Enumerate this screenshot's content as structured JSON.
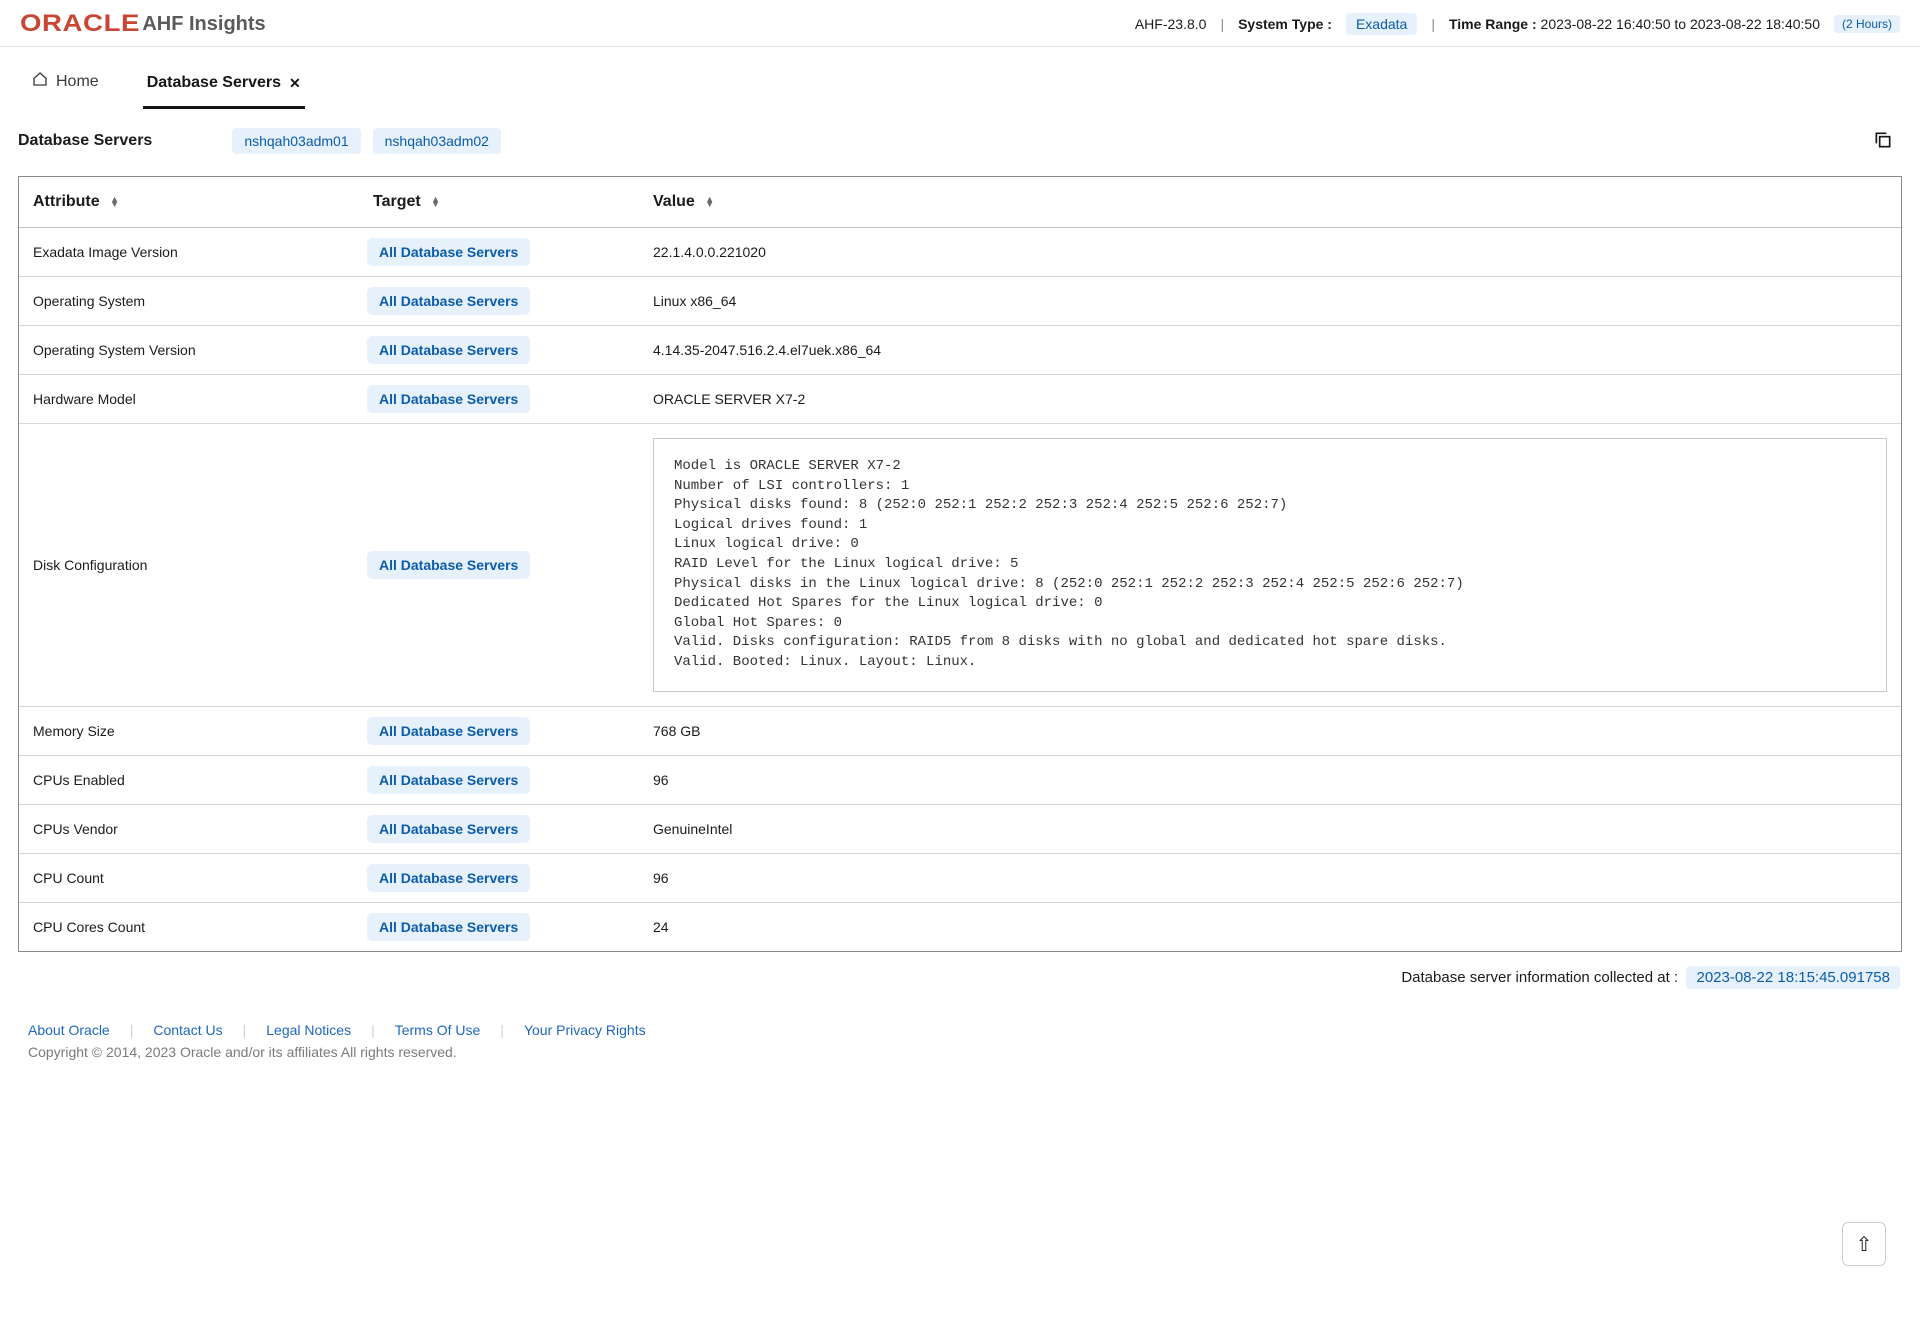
{
  "header": {
    "brand": "ORACLE",
    "product": "AHF Insights",
    "version": "AHF-23.8.0",
    "system_type_label": "System Type :",
    "system_type_value": "Exadata",
    "time_range_label": "Time Range :",
    "time_range_value": "2023-08-22 16:40:50 to 2023-08-22 18:40:50",
    "time_range_duration": "(2 Hours)"
  },
  "tabs": {
    "home": "Home",
    "db_servers": "Database Servers"
  },
  "section": {
    "title": "Database Servers",
    "servers": [
      "nshqah03adm01",
      "nshqah03adm02"
    ]
  },
  "table": {
    "columns": {
      "attribute": "Attribute",
      "target": "Target",
      "value": "Value"
    },
    "target_label": "All Database Servers",
    "rows": [
      {
        "attribute": "Exadata Image Version",
        "value": "22.1.4.0.0.221020"
      },
      {
        "attribute": "Operating System",
        "value": "Linux x86_64"
      },
      {
        "attribute": "Operating System Version",
        "value": "4.14.35-2047.516.2.4.el7uek.x86_64"
      },
      {
        "attribute": "Hardware Model",
        "value": "ORACLE SERVER X7-2"
      },
      {
        "attribute": "Disk Configuration",
        "value": "Model is ORACLE SERVER X7-2\nNumber of LSI controllers: 1\nPhysical disks found: 8 (252:0 252:1 252:2 252:3 252:4 252:5 252:6 252:7)\nLogical drives found: 1\nLinux logical drive: 0\nRAID Level for the Linux logical drive: 5\nPhysical disks in the Linux logical drive: 8 (252:0 252:1 252:2 252:3 252:4 252:5 252:6 252:7)\nDedicated Hot Spares for the Linux logical drive: 0\nGlobal Hot Spares: 0\nValid. Disks configuration: RAID5 from 8 disks with no global and dedicated hot spare disks.\nValid. Booted: Linux. Layout: Linux.",
        "pre": true
      },
      {
        "attribute": "Memory Size",
        "value": "768 GB"
      },
      {
        "attribute": "CPUs Enabled",
        "value": "96"
      },
      {
        "attribute": "CPUs Vendor",
        "value": "GenuineIntel"
      },
      {
        "attribute": "CPU Count",
        "value": "96"
      },
      {
        "attribute": "CPU Cores Count",
        "value": "24"
      }
    ]
  },
  "collected": {
    "label": "Database server information collected at :",
    "value": "2023-08-22 18:15:45.091758"
  },
  "footer": {
    "links": [
      "About Oracle",
      "Contact Us",
      "Legal Notices",
      "Terms Of Use",
      "Your Privacy Rights"
    ],
    "copyright": "Copyright © 2014, 2023 Oracle and/or its affiliates All rights reserved."
  }
}
